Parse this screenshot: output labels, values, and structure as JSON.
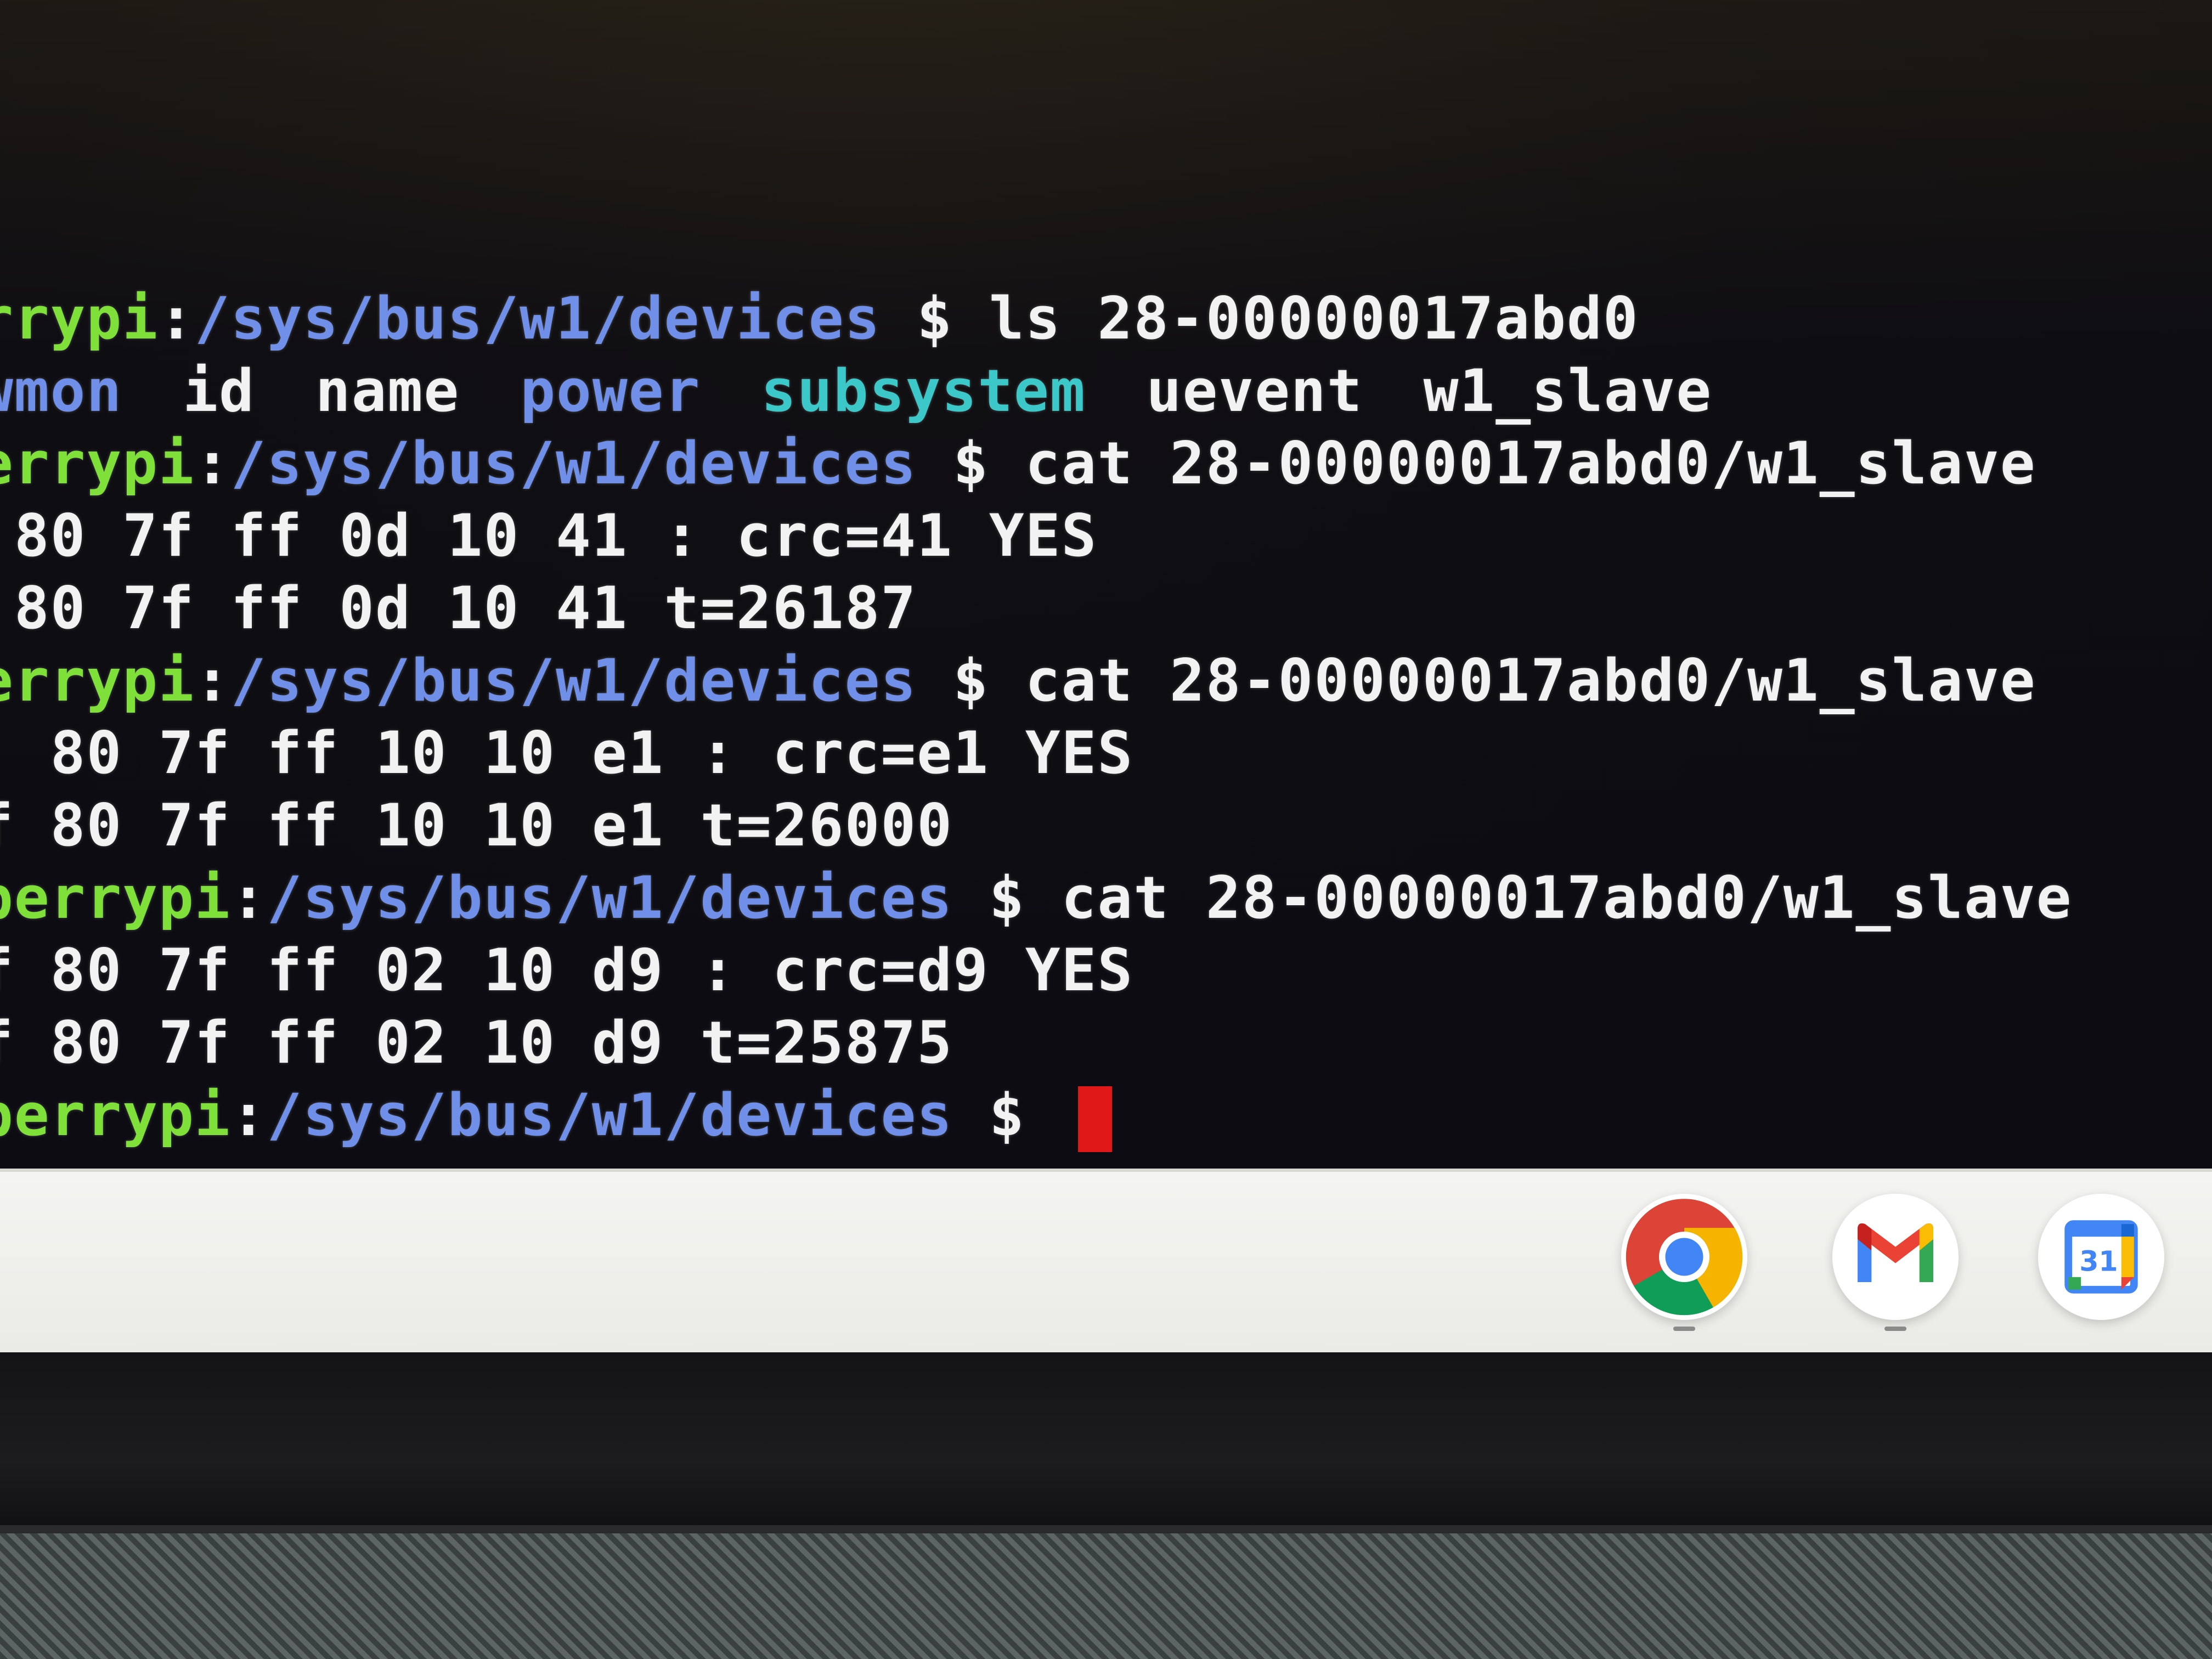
{
  "terminal": {
    "lines": [
      {
        "kind": "prompt",
        "user": "rrypi",
        "sep": ":",
        "path": "/sys/bus/w1/devices",
        "sign": " $ ",
        "command": "ls 28-00000017abd0"
      },
      {
        "kind": "listing",
        "entries": [
          {
            "text": "wmon",
            "type": "dir"
          },
          {
            "text": "id",
            "type": "file"
          },
          {
            "text": "name",
            "type": "file"
          },
          {
            "text": "power",
            "type": "dir"
          },
          {
            "text": "subsystem",
            "type": "link"
          },
          {
            "text": "uevent",
            "type": "file"
          },
          {
            "text": "w1_slave",
            "type": "file"
          }
        ]
      },
      {
        "kind": "prompt",
        "user": "errypi",
        "sep": ":",
        "path": "/sys/bus/w1/devices",
        "sign": " $ ",
        "command": "cat 28-00000017abd0/w1_slave"
      },
      {
        "kind": "output",
        "text": " 80 7f ff 0d 10 41 : crc=41 YES"
      },
      {
        "kind": "output",
        "text": " 80 7f ff 0d 10 41 t=26187"
      },
      {
        "kind": "prompt",
        "user": "errypi",
        "sep": ":",
        "path": "/sys/bus/w1/devices",
        "sign": " $ ",
        "command": "cat 28-00000017abd0/w1_slave"
      },
      {
        "kind": "output",
        "text": "  80 7f ff 10 10 e1 : crc=e1 YES"
      },
      {
        "kind": "output",
        "text": "f 80 7f ff 10 10 e1 t=26000"
      },
      {
        "kind": "prompt",
        "user": "berrypi",
        "sep": ":",
        "path": "/sys/bus/w1/devices",
        "sign": " $ ",
        "command": "cat 28-00000017abd0/w1_slave"
      },
      {
        "kind": "output",
        "text": "f 80 7f ff 02 10 d9 : crc=d9 YES"
      },
      {
        "kind": "output",
        "text": "f 80 7f ff 02 10 d9 t=25875"
      },
      {
        "kind": "prompt-active",
        "user": "berrypi",
        "sep": ":",
        "path": "/sys/bus/w1/devices",
        "sign": " $ ",
        "command": ""
      }
    ]
  },
  "shelf": {
    "apps": [
      {
        "name": "chrome-icon",
        "label": ""
      },
      {
        "name": "gmail-icon",
        "label": ""
      },
      {
        "name": "calendar-icon",
        "label": "31"
      }
    ]
  },
  "colors": {
    "prompt_user": "#7fe03a",
    "prompt_path": "#6f8fe8",
    "link_entry": "#3cc8c8",
    "cursor": "#e01818",
    "shelf_bg": "#f4f4f2"
  }
}
